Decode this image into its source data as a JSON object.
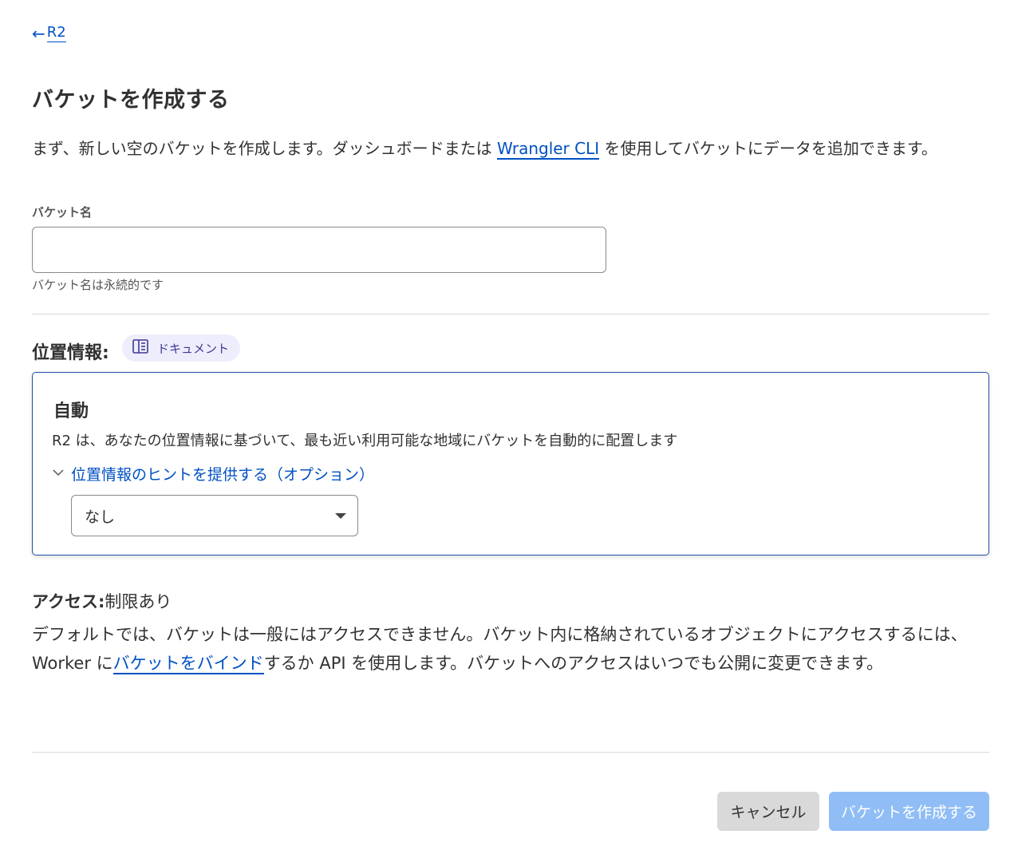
{
  "nav": {
    "back_arrow": "←",
    "back_label": "R2"
  },
  "page": {
    "title": "バケットを作成する",
    "intro_before": "まず、新しい空のバケットを作成します。ダッシュボードまたは ",
    "intro_link": "Wrangler CLI",
    "intro_after": " を使用してバケットにデータを追加できます。"
  },
  "bucket_name": {
    "label": "バケット名",
    "value": "",
    "placeholder": "",
    "hint": "バケット名は永続的です"
  },
  "location": {
    "title": "位置情報:",
    "doc_badge": "ドキュメント",
    "doc_icon": "book-icon",
    "card": {
      "title": "自動",
      "description": "R2 は、あなたの位置情報に基づいて、最も近い利用可能な地域にバケットを自動的に配置します",
      "toggle_label": "位置情報のヒントを提供する（オプション）",
      "toggle_icon": "chevron-down-icon",
      "select_value": "なし"
    }
  },
  "access": {
    "title_bold": "アクセス:",
    "title_value": "制限あり",
    "desc_before": "デフォルトでは、バケットは一般にはアクセスできません。バケット内に格納されているオブジェクトにアクセスするには、Worker に",
    "desc_link": "バケットをバインド",
    "desc_after": "するか API を使用します。バケットへのアクセスはいつでも公開に変更できます。"
  },
  "actions": {
    "cancel_label": "キャンセル",
    "create_label": "バケットを作成する"
  },
  "colors": {
    "link": "#0051c3",
    "card_border": "#1f4fa5",
    "badge_bg": "#eeedfc",
    "create_button_disabled": "#90bdf5",
    "cancel_button": "#d9d9d9"
  }
}
